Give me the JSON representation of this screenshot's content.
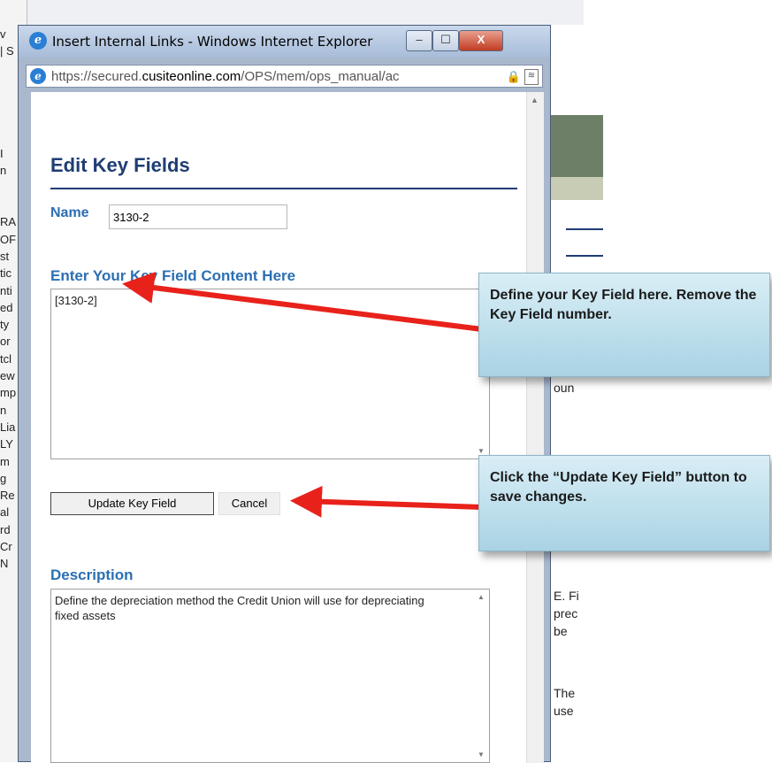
{
  "background": {
    "left_fragments": [
      "v",
      "| S",
      "",
      "",
      "",
      "",
      "",
      "I",
      "n",
      "",
      "",
      "RA",
      "OF",
      "st",
      "tic",
      "nti",
      "ed",
      "ty",
      "or",
      "tcl",
      "ew",
      "mp",
      "n",
      "Lia",
      "LY",
      "m",
      "g",
      "Re",
      "al",
      "rd",
      "Cr",
      "N"
    ],
    "right_fragments": [
      "oun",
      "E. Fi",
      "prec",
      "be",
      "The",
      "use"
    ]
  },
  "window": {
    "title": "Insert Internal Links - Windows Internet Explorer",
    "url_prefix": "https://secured.",
    "url_domain": "cusiteonline.com",
    "url_rest": "/OPS/mem/ops_manual/ac",
    "ie_icon": "ie-logo-icon",
    "minimize_icon": "minimize-icon",
    "maximize_icon": "maximize-icon",
    "close_icon": "close-icon",
    "minimize_glyph": "‒",
    "maximize_glyph": "☐",
    "close_glyph": "X",
    "lock_icon": "lock-icon",
    "lock_glyph": "🔒",
    "cert_icon": "certificate-icon",
    "cert_glyph": "≋"
  },
  "dialog": {
    "title": "Edit Key Fields",
    "name_label": "Name",
    "name_value": "3130-2",
    "content_heading": "Enter Your Key Field Content Here",
    "content_value": "[3130-2]",
    "update_button": "Update Key Field",
    "cancel_button": "Cancel",
    "description_heading": "Description",
    "description_value": "Define the depreciation method the Credit Union will use for depreciating fixed assets"
  },
  "callouts": {
    "define": "Define your Key Field here. Remove the Key Field number.",
    "click_update": "Click the “Update Key Field” button to save changes."
  },
  "colors": {
    "heading": "#1f3d73",
    "label": "#2b6fb3",
    "arrow": "#e8221b",
    "callout": "#b9dbe9"
  }
}
